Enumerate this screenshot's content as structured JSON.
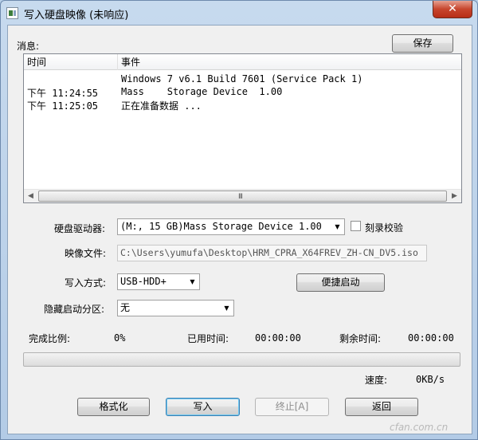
{
  "window": {
    "title": "写入硬盘映像 (未响应)",
    "close_glyph": "✕"
  },
  "messages": {
    "label": "消息:",
    "save_button": "保存",
    "columns": [
      "时间",
      "事件"
    ],
    "rows": [
      {
        "time": "",
        "event": "Windows 7 v6.1 Build 7601 (Service Pack 1)"
      },
      {
        "time": "下午 11:24:55",
        "event": "Mass    Storage Device  1.00"
      },
      {
        "time": "下午 11:25:05",
        "event": "正在准备数据 ..."
      }
    ],
    "scroll_grip": "III"
  },
  "form": {
    "drive_label": "硬盘驱动器:",
    "drive_value": "(M:, 15 GB)Mass    Storage Device  1.00",
    "verify_label": "刻录校验",
    "image_label": "映像文件:",
    "image_value": "C:\\Users\\yumufa\\Desktop\\HRM_CPRA_X64FREV_ZH-CN_DV5.iso",
    "write_mode_label": "写入方式:",
    "write_mode_value": "USB-HDD+",
    "quick_boot_button": "便捷启动",
    "hidden_partition_label": "隐藏启动分区:",
    "hidden_partition_value": "无"
  },
  "status": {
    "progress_label": "完成比例:",
    "progress_value": "0%",
    "progress_fraction": 0,
    "elapsed_label": "已用时间:",
    "elapsed_value": "00:00:00",
    "remaining_label": "剩余时间:",
    "remaining_value": "00:00:00",
    "speed_label": "速度:",
    "speed_value": "0KB/s"
  },
  "buttons": {
    "format": "格式化",
    "write": "写入",
    "stop": "终止[A]",
    "back": "返回"
  },
  "watermark": "cfan.com.cn",
  "icons": {
    "scroll_left": "◀",
    "scroll_right": "▶",
    "dropdown": "▼"
  }
}
